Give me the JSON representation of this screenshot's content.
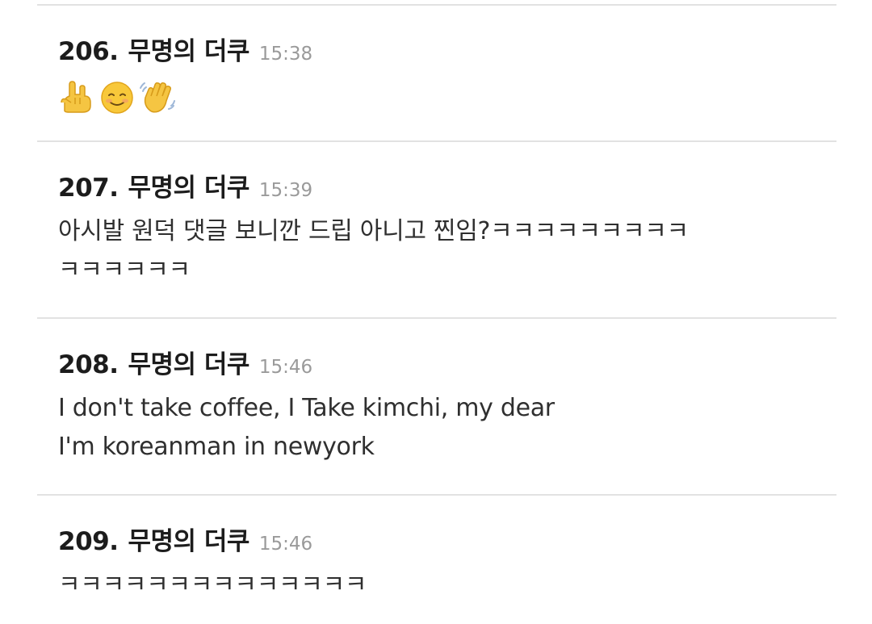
{
  "comments": [
    {
      "number": "206.",
      "author": "무명의 더쿠",
      "time": "15:38",
      "emojis": [
        "sign-of-horns-icon",
        "smiling-face-icon",
        "waving-hand-icon"
      ]
    },
    {
      "number": "207.",
      "author": "무명의 더쿠",
      "time": "15:39",
      "lines": [
        "아시발 원덕 댓글 보니깐 드립 아니고 찐임?ㅋㅋㅋㅋㅋㅋㅋㅋㅋ",
        "ㅋㅋㅋㅋㅋㅋ"
      ]
    },
    {
      "number": "208.",
      "author": "무명의 더쿠",
      "time": "15:46",
      "lines": [
        "I don't take coffee, I Take kimchi, my dear",
        "I'm koreanman in newyork"
      ]
    },
    {
      "number": "209.",
      "author": "무명의 더쿠",
      "time": "15:46",
      "lines": [
        "ㅋㅋㅋㅋㅋㅋㅋㅋㅋㅋㅋㅋㅋㅋ"
      ]
    }
  ]
}
